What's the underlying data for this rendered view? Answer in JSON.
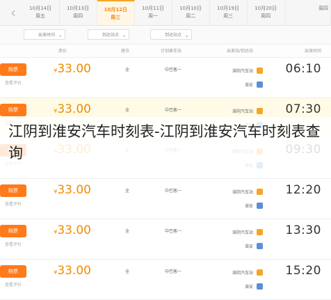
{
  "date_bar": {
    "prev_icon": "chevron-left-icon",
    "dates": [
      {
        "date": "10月14日",
        "weekday": "周五",
        "active": false
      },
      {
        "date": "10月13日",
        "weekday": "周四",
        "active": false
      },
      {
        "date": "10月12日",
        "weekday": "周三",
        "active": true
      },
      {
        "date": "10月11日",
        "weekday": "周一",
        "active": false
      },
      {
        "date": "10月10日",
        "weekday": "周二",
        "active": false
      },
      {
        "date": "10月19日",
        "weekday": "周三",
        "active": false
      },
      {
        "date": "10月20日",
        "weekday": "周四",
        "active": false
      }
    ],
    "tail_text": "周四"
  },
  "filters": {
    "depart_time": "出发时间",
    "depart_station": "到达站点",
    "arrive_station": "到达站点"
  },
  "columns": {
    "depart": "出发时间",
    "stations": "出发站/到达站",
    "route": "计划乘车站",
    "seat": "座位",
    "price": "票价"
  },
  "overlay": {
    "title": "江阴到淮安汽车时刻表-江阴到淮安汽车时刻表查询"
  },
  "colors": {
    "accent": "#f08c00",
    "button": "#ff7a1a",
    "tag_orange": "#f5a623",
    "tag_blue": "#5b8fd6"
  },
  "rows": [
    {
      "time": "06:10",
      "from": "淮阴汽车站",
      "to": "淮安",
      "route": "中巴客一",
      "seat": "全",
      "price": "33.00",
      "currency": "¥",
      "buy": "购票",
      "sub": "查看评价"
    },
    {
      "time": "07:30",
      "from": "淮阴汽车站",
      "to": "淮安",
      "route": "中巴客一",
      "seat": "全",
      "price": "33.00",
      "currency": "¥",
      "buy": "购票",
      "sub": "查看评价"
    },
    {
      "time": "09:30",
      "from": "淮阴汽车站",
      "to": "淮安",
      "route": "中巴客一",
      "seat": "全",
      "price": "33.00",
      "currency": "¥",
      "buy": "购票",
      "sub": "查看评价"
    },
    {
      "time": "12:20",
      "from": "淮阴汽车站",
      "to": "淮安",
      "route": "中巴客一",
      "seat": "全",
      "price": "33.00",
      "currency": "¥",
      "buy": "购票",
      "sub": "查看评价"
    },
    {
      "time": "13:30",
      "from": "淮阴汽车站",
      "to": "淮安",
      "route": "中巴客一",
      "seat": "全",
      "price": "33.00",
      "currency": "¥",
      "buy": "购票",
      "sub": "查看评价"
    },
    {
      "time": "15:20",
      "from": "淮阴汽车站",
      "to": "淮安",
      "route": "中巴客一",
      "seat": "全",
      "price": "33.00",
      "currency": "¥",
      "buy": "购票",
      "sub": "查看评价"
    }
  ]
}
